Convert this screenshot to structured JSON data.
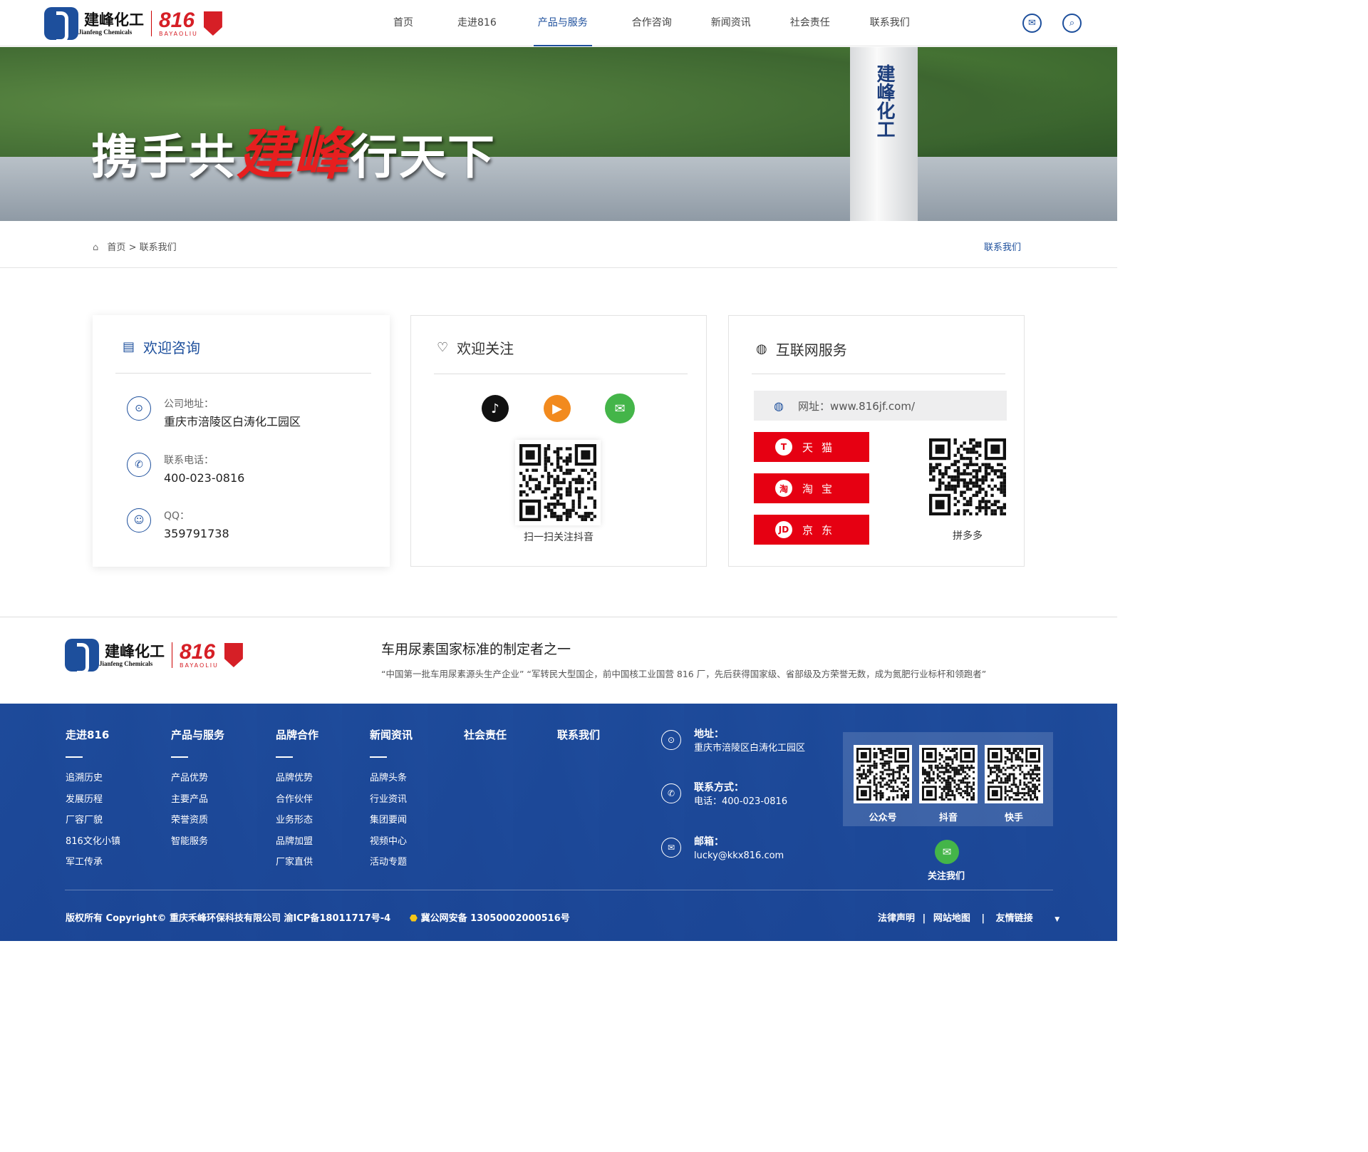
{
  "header": {
    "logo_cn": "建峰化工",
    "logo_en": "Jianfeng Chemicals",
    "brand_num": "816",
    "brand_sub": "BAYAOLIU",
    "nav": [
      "首页",
      "走进816",
      "产品与服务",
      "合作咨询",
      "新闻资讯",
      "社会责任",
      "联系我们"
    ],
    "active_nav": "产品与服务",
    "icons": [
      "wechat-icon",
      "search-icon"
    ]
  },
  "banner": {
    "slogan_a": "携手共",
    "slogan_red": "建峰",
    "slogan_b": "行天下",
    "tower_text": "建峰化工"
  },
  "breadcrumb": {
    "home": "首页",
    "separator": ">",
    "current": "联系我们",
    "right_label": "联系我们"
  },
  "consult": {
    "title": "欢迎咨询",
    "items": [
      {
        "label": "公司地址：",
        "value": "重庆市涪陵区白涛化工园区",
        "icon": "location-icon"
      },
      {
        "label": "联系电话：",
        "value": "400-023-0816",
        "icon": "phone-icon"
      },
      {
        "label": "QQ：",
        "value": "359791738",
        "icon": "qq-icon"
      }
    ]
  },
  "follow": {
    "title": "欢迎关注",
    "social": [
      "douyin-icon",
      "kuaishou-icon",
      "wechat-icon"
    ],
    "qr_caption": "扫一扫关注抖音"
  },
  "internet": {
    "title": "互联网服务",
    "url_label": "网址：www.816jf.com/",
    "shops": [
      {
        "name": "天猫",
        "badge": "T"
      },
      {
        "name": "淘宝",
        "badge": "淘"
      },
      {
        "name": "京东",
        "badge": "JD"
      }
    ],
    "qr_caption": "拼多多"
  },
  "footer_intro": {
    "title": "车用尿素国家标准的制定者之一",
    "desc": "“中国第一批车用尿素源头生产企业” “军转民大型国企，前中国核工业国营 816 厂，先后获得国家级、省部级及方荣誉无数，成为氮肥行业标杆和领跑者”"
  },
  "footer": {
    "columns": [
      {
        "title": "走进816",
        "items": [
          "追溯历史",
          "发展历程",
          "厂容厂貌",
          "816文化小镇",
          "军工传承"
        ]
      },
      {
        "title": "产品与服务",
        "items": [
          "产品优势",
          "主要产品",
          "荣誉资质",
          "智能服务"
        ]
      },
      {
        "title": "品牌合作",
        "items": [
          "品牌优势",
          "合作伙伴",
          "业务形态",
          "品牌加盟",
          "厂家直供"
        ]
      },
      {
        "title": "新闻资讯",
        "items": [
          "品牌头条",
          "行业资讯",
          "集团要闻",
          "视频中心",
          "活动专题"
        ]
      },
      {
        "title": "社会责任",
        "items": []
      },
      {
        "title": "联系我们",
        "items": []
      }
    ],
    "contact": [
      {
        "label": "地址：",
        "value": "重庆市涪陵区白涛化工园区"
      },
      {
        "label": "联系方式：",
        "value": "电话：400-023-0816"
      },
      {
        "label": "邮箱：",
        "value": "lucky@kkx816.com"
      }
    ],
    "qrs": [
      "公众号",
      "抖音",
      "快手"
    ],
    "follow_label": "关注我们",
    "copyright": "版权所有 Copyright© 重庆禾峰环保科技有限公司   渝ICP备18011717号-4",
    "police": "冀公网安备 13050002000516号",
    "links": [
      "法律声明",
      "网站地图",
      "友情链接"
    ]
  },
  "colors": {
    "brand_blue": "#1d4f9c",
    "brand_red": "#e60012",
    "footer_bg": "#1d4a9a"
  }
}
